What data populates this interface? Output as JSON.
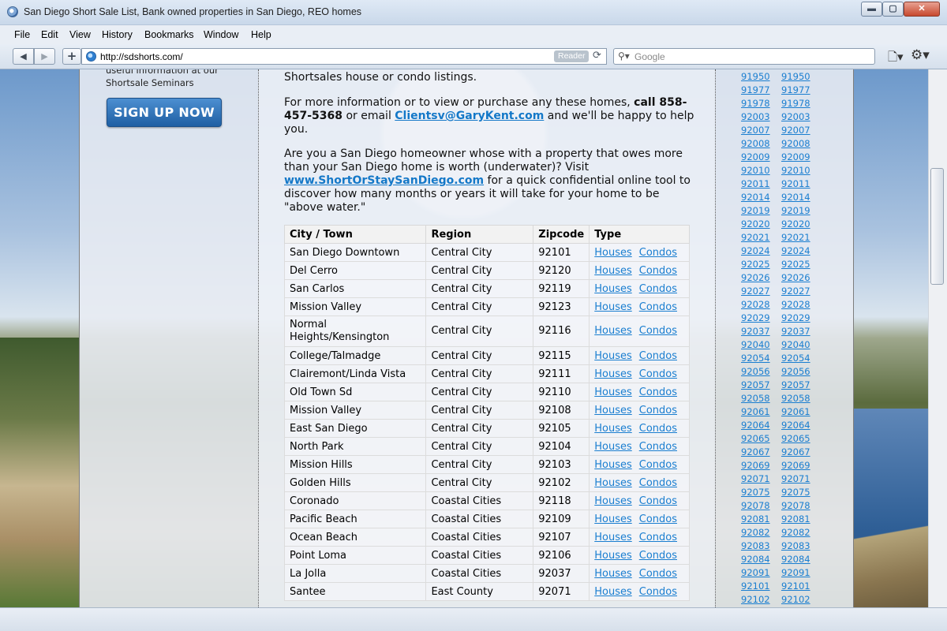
{
  "window": {
    "title": "San Diego Short Sale List, Bank owned properties in San Diego, REO homes",
    "buttons": {
      "minimize": "▬",
      "maximize": "▢",
      "close": "✕"
    }
  },
  "menu": [
    "File",
    "Edit",
    "View",
    "History",
    "Bookmarks",
    "Window",
    "Help"
  ],
  "toolbar": {
    "back": "◀",
    "forward": "▶",
    "new_tab": "+",
    "url": "http://sdshorts.com/",
    "reader": "Reader",
    "search_placeholder": "Google"
  },
  "sidebar": {
    "seminar_text_1": "useful information at our",
    "seminar_text_2": "Shortsale Seminars",
    "signup_label": "SIGN UP NOW"
  },
  "content": {
    "p1": "Shortsales house or condo listings.",
    "p2_a": "For more information or to view or purchase any these homes, ",
    "p2_call": "call 858-457-5368",
    "p2_b": " or email ",
    "p2_email": "Clientsv@GaryKent.com",
    "p2_c": " and we'll be happy to help you.",
    "p3_a": "Are you a San Diego homeowner whose with a property that owes more than your San Diego home is worth (underwater)? Visit ",
    "p3_link": "www.ShortOrStaySanDiego.com",
    "p3_b": " for a quick confidential online tool to discover how many months or years it will take for your home to be \"above water.\""
  },
  "table": {
    "headers": [
      "City / Town",
      "Region",
      "Zipcode",
      "Type"
    ],
    "houses_label": "Houses",
    "condos_label": "Condos",
    "rows": [
      {
        "city": "San Diego Downtown",
        "region": "Central City",
        "zip": "92101"
      },
      {
        "city": "Del Cerro",
        "region": "Central City",
        "zip": "92120"
      },
      {
        "city": "San Carlos",
        "region": "Central City",
        "zip": "92119"
      },
      {
        "city": "Mission Valley",
        "region": "Central City",
        "zip": "92123"
      },
      {
        "city": "Normal Heights/Kensington",
        "region": "Central City",
        "zip": "92116"
      },
      {
        "city": "College/Talmadge",
        "region": "Central City",
        "zip": "92115"
      },
      {
        "city": "Clairemont/Linda Vista",
        "region": "Central City",
        "zip": "92111"
      },
      {
        "city": "Old Town Sd",
        "region": "Central City",
        "zip": "92110"
      },
      {
        "city": "Mission Valley",
        "region": "Central City",
        "zip": "92108"
      },
      {
        "city": "East San Diego",
        "region": "Central City",
        "zip": "92105"
      },
      {
        "city": "North Park",
        "region": "Central City",
        "zip": "92104"
      },
      {
        "city": "Mission Hills",
        "region": "Central City",
        "zip": "92103"
      },
      {
        "city": "Golden Hills",
        "region": "Central City",
        "zip": "92102"
      },
      {
        "city": "Coronado",
        "region": "Coastal Cities",
        "zip": "92118"
      },
      {
        "city": "Pacific Beach",
        "region": "Coastal Cities",
        "zip": "92109"
      },
      {
        "city": "Ocean Beach",
        "region": "Coastal Cities",
        "zip": "92107"
      },
      {
        "city": "Point Loma",
        "region": "Coastal Cities",
        "zip": "92106"
      },
      {
        "city": "La Jolla",
        "region": "Coastal Cities",
        "zip": "92037"
      },
      {
        "city": "Santee",
        "region": "East County",
        "zip": "92071"
      }
    ]
  },
  "zip_list": [
    "91950",
    "91977",
    "91978",
    "92003",
    "92007",
    "92008",
    "92009",
    "92010",
    "92011",
    "92014",
    "92019",
    "92020",
    "92021",
    "92024",
    "92025",
    "92026",
    "92027",
    "92028",
    "92029",
    "92037",
    "92040",
    "92054",
    "92056",
    "92057",
    "92058",
    "92061",
    "92064",
    "92065",
    "92067",
    "92069",
    "92071",
    "92075",
    "92078",
    "92081",
    "92082",
    "92083",
    "92084",
    "92091",
    "92101",
    "92102"
  ]
}
